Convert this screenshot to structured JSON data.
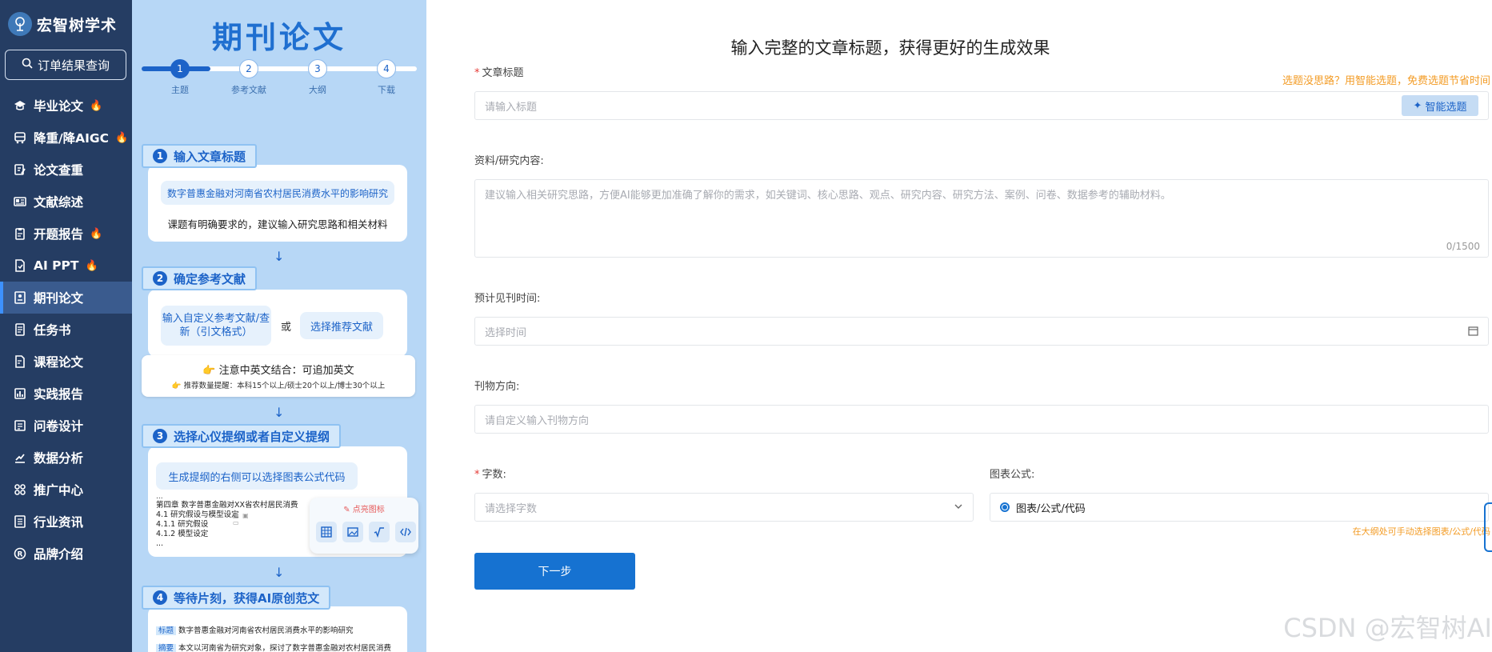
{
  "sidebar": {
    "brand": "宏智树学术",
    "order_query": "订单结果查询",
    "items": [
      {
        "label": "毕业论文",
        "hot": true,
        "icon": "graduation-cap-icon"
      },
      {
        "label": "降重/降AIGC",
        "hot": true,
        "icon": "bus-icon"
      },
      {
        "label": "论文查重",
        "hot": false,
        "icon": "document-edit-icon"
      },
      {
        "label": "文献综述",
        "hot": false,
        "icon": "newspaper-icon"
      },
      {
        "label": "开题报告",
        "hot": true,
        "icon": "clipboard-icon"
      },
      {
        "label": "AI PPT",
        "hot": true,
        "icon": "file-code-icon"
      },
      {
        "label": "期刊论文",
        "hot": false,
        "icon": "journal-icon",
        "active": true
      },
      {
        "label": "任务书",
        "hot": false,
        "icon": "book-icon"
      },
      {
        "label": "课程论文",
        "hot": false,
        "icon": "file-pen-icon"
      },
      {
        "label": "实践报告",
        "hot": false,
        "icon": "report-chart-icon"
      },
      {
        "label": "问卷设计",
        "hot": false,
        "icon": "survey-icon"
      },
      {
        "label": "数据分析",
        "hot": false,
        "icon": "chart-up-icon"
      },
      {
        "label": "推广中心",
        "hot": false,
        "icon": "grid-icon"
      },
      {
        "label": "行业资讯",
        "hot": false,
        "icon": "news-icon"
      },
      {
        "label": "品牌介绍",
        "hot": false,
        "icon": "registered-icon"
      }
    ]
  },
  "guide": {
    "title": "期刊论文",
    "steps": [
      {
        "num": "1",
        "label": "主题"
      },
      {
        "num": "2",
        "label": "参考文献"
      },
      {
        "num": "3",
        "label": "大纲"
      },
      {
        "num": "4",
        "label": "下载"
      }
    ],
    "card1": {
      "num": "1",
      "title": "输入文章标题",
      "example": "数字普惠金融对河南省农村居民消费水平的影响研究",
      "tip": "课题有明确要求的，建议输入研究思路和相关材料"
    },
    "card2": {
      "num": "2",
      "title": "确定参考文献",
      "custom": "输入自定义参考文献/查新（引文格式）",
      "or": "或",
      "recommend": "选择推荐文献",
      "note": "注意中英文结合：可追加英文",
      "note_sub": "推荐数量提醒：本科15个以上/硕士20个以上/博士30个以上"
    },
    "card3": {
      "num": "3",
      "title": "选择心仪提纲或者自定义提纲",
      "pill": "生成提纲的右侧可以选择图表公式代码",
      "dots": "...",
      "lines": [
        "第四章 数字普惠金融对XX省农村居民消费",
        "4.1 研究假设与模型设定",
        "4.1.1 研究假设",
        "4.1.2 模型设定"
      ],
      "dots2": "...",
      "popup_label": "点亮图标"
    },
    "card4": {
      "num": "4",
      "title": "等待片刻，获得AI原创范文",
      "tag_title": "标题",
      "title_text": "数字普惠金融对河南省农村居民消费水平的影响研究",
      "tag_abstract": "摘要",
      "abstract_text": "本文以河南省为研究对象，探讨了数字普惠金融对农村居民消费"
    }
  },
  "form": {
    "heading": "输入完整的文章标题，获得更好的生成效果",
    "title_label": "文章标题",
    "title_hint": "选题没思路？用智能选题，免费选题节省时间",
    "title_placeholder": "请输入标题",
    "smart_button": "智能选题",
    "content_label": "资料/研究内容:",
    "content_placeholder": "建议输入相关研究思路，方便AI能够更加准确了解你的需求，如关键词、核心思路、观点、研究内容、研究方法、案例、问卷、数据参考的辅助材料。",
    "content_counter": "0/1500",
    "date_label": "预计见刊时间:",
    "date_placeholder": "选择时间",
    "direction_label": "刊物方向:",
    "direction_placeholder": "请自定义输入刊物方向",
    "words_label": "字数:",
    "words_placeholder": "请选择字数",
    "chart_label": "图表公式:",
    "chart_option": "图表/公式/代码",
    "chart_hint": "在大纲处可手动选择图表/公式/代码",
    "next_button": "下一步"
  },
  "watermark": "CSDN @宏智树AI",
  "colors": {
    "sidebar_bg": "#253d63",
    "guide_bg": "#b7d7f6",
    "primary": "#1672d1",
    "hint": "#f39c26",
    "required": "#e53935"
  }
}
